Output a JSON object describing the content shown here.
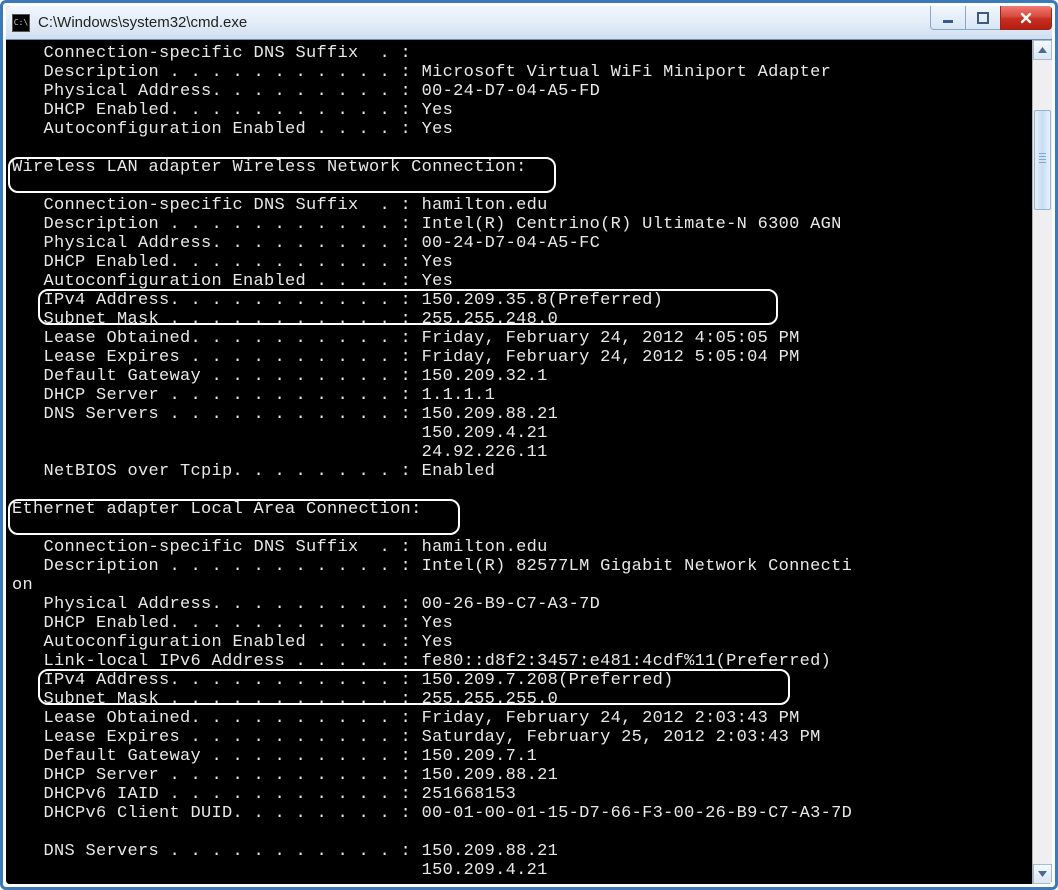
{
  "window": {
    "icon_text": "C:\\",
    "title": "C:\\Windows\\system32\\cmd.exe"
  },
  "terminal": {
    "lines": {
      "l01": "   Connection-specific DNS Suffix  . :",
      "l02": "   Description . . . . . . . . . . . : Microsoft Virtual WiFi Miniport Adapter",
      "l03": "   Physical Address. . . . . . . . . : 00-24-D7-04-A5-FD",
      "l04": "   DHCP Enabled. . . . . . . . . . . : Yes",
      "l05": "   Autoconfiguration Enabled . . . . : Yes",
      "l06": "",
      "l07": "Wireless LAN adapter Wireless Network Connection:",
      "l08": "",
      "l09": "   Connection-specific DNS Suffix  . : hamilton.edu",
      "l10": "   Description . . . . . . . . . . . : Intel(R) Centrino(R) Ultimate-N 6300 AGN",
      "l11": "   Physical Address. . . . . . . . . : 00-24-D7-04-A5-FC",
      "l12": "   DHCP Enabled. . . . . . . . . . . : Yes",
      "l13": "   Autoconfiguration Enabled . . . . : Yes",
      "l14": "   IPv4 Address. . . . . . . . . . . : 150.209.35.8(Preferred)",
      "l15": "   Subnet Mask . . . . . . . . . . . : 255.255.248.0",
      "l16": "   Lease Obtained. . . . . . . . . . : Friday, February 24, 2012 4:05:05 PM",
      "l17": "   Lease Expires . . . . . . . . . . : Friday, February 24, 2012 5:05:04 PM",
      "l18": "   Default Gateway . . . . . . . . . : 150.209.32.1",
      "l19": "   DHCP Server . . . . . . . . . . . : 1.1.1.1",
      "l20": "   DNS Servers . . . . . . . . . . . : 150.209.88.21",
      "l21": "                                       150.209.4.21",
      "l22": "                                       24.92.226.11",
      "l23": "   NetBIOS over Tcpip. . . . . . . . : Enabled",
      "l24": "",
      "l25": "Ethernet adapter Local Area Connection:",
      "l26": "",
      "l27": "   Connection-specific DNS Suffix  . : hamilton.edu",
      "l28": "   Description . . . . . . . . . . . : Intel(R) 82577LM Gigabit Network Connecti",
      "l29": "on",
      "l30": "   Physical Address. . . . . . . . . : 00-26-B9-C7-A3-7D",
      "l31": "   DHCP Enabled. . . . . . . . . . . : Yes",
      "l32": "   Autoconfiguration Enabled . . . . : Yes",
      "l33": "   Link-local IPv6 Address . . . . . : fe80::d8f2:3457:e481:4cdf%11(Preferred)",
      "l34": "   IPv4 Address. . . . . . . . . . . : 150.209.7.208(Preferred)",
      "l35": "   Subnet Mask . . . . . . . . . . . : 255.255.255.0",
      "l36": "   Lease Obtained. . . . . . . . . . : Friday, February 24, 2012 2:03:43 PM",
      "l37": "   Lease Expires . . . . . . . . . . : Saturday, February 25, 2012 2:03:43 PM",
      "l38": "   Default Gateway . . . . . . . . . : 150.209.7.1",
      "l39": "   DHCP Server . . . . . . . . . . . : 150.209.88.21",
      "l40": "   DHCPv6 IAID . . . . . . . . . . . : 251668153",
      "l41": "   DHCPv6 Client DUID. . . . . . . . : 00-01-00-01-15-D7-66-F3-00-26-B9-C7-A3-7D",
      "l42": "",
      "l43": "   DNS Servers . . . . . . . . . . . : 150.209.88.21",
      "l44": "                                       150.209.4.21"
    }
  }
}
